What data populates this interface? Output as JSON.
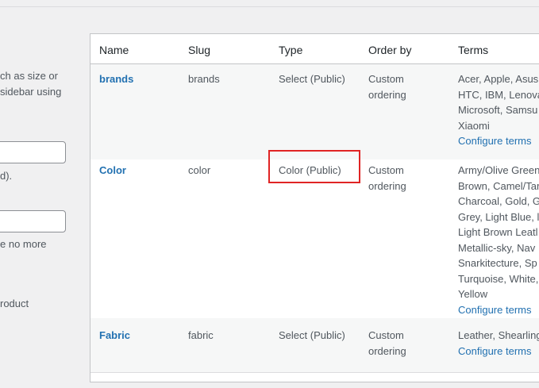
{
  "left_panel": {
    "texts": [
      "ch as size or",
      " sidebar using",
      "d).",
      "e no more",
      "roduct"
    ]
  },
  "table": {
    "headers": {
      "name": "Name",
      "slug": "Slug",
      "type": "Type",
      "order_by": "Order by",
      "terms": "Terms"
    },
    "rows": [
      {
        "name": "brands",
        "slug": "brands",
        "type": "Select (Public)",
        "order_by": "Custom ordering",
        "terms_lines": [
          "Acer, Apple, Asus",
          "HTC, IBM, Lenova",
          "Microsoft, Samsu",
          "Xiaomi"
        ],
        "configure": "Configure terms"
      },
      {
        "name": "Color",
        "slug": "color",
        "type": "Color (Public)",
        "order_by": "Custom ordering",
        "terms_lines": [
          "Army/Olive Green",
          "Brown, Camel/Tar",
          "Charcoal, Gold, G",
          "Grey, Light Blue, l",
          "Light Brown Leatl",
          "Metallic-sky, Nav",
          "Snarkitecture, Sp",
          "Turquoise, White,",
          "Yellow"
        ],
        "configure": "Configure terms"
      },
      {
        "name": "Fabric",
        "slug": "fabric",
        "type": "Select (Public)",
        "order_by": "Custom ordering",
        "terms_lines": [
          "Leather, Shearling"
        ],
        "configure": "Configure terms"
      }
    ]
  },
  "colors": {
    "link": "#2271b1",
    "highlight": "#e02424",
    "alt_row": "#f6f7f7"
  }
}
